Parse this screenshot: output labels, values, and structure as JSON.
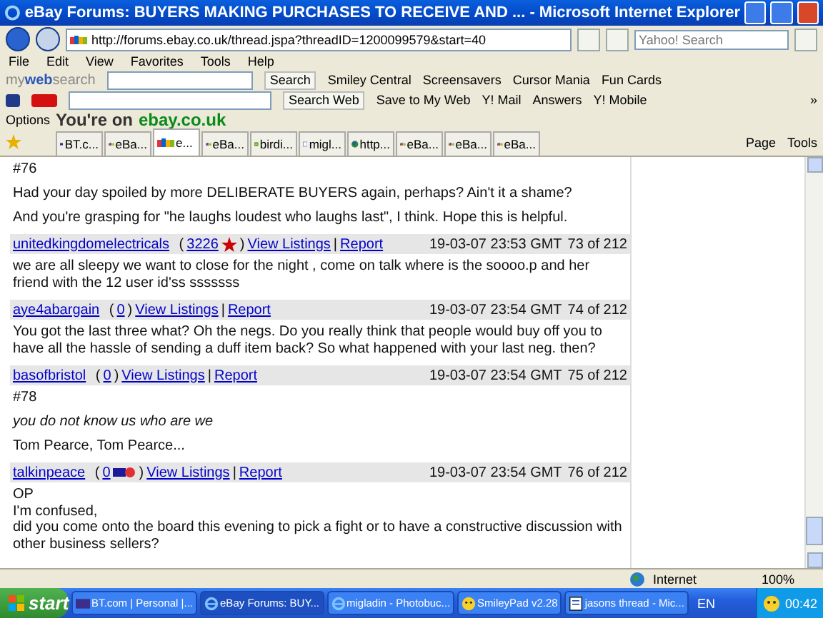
{
  "window": {
    "title": "eBay Forums: BUYERS MAKING PURCHASES TO RECEIVE AND ... - Microsoft Internet Explorer"
  },
  "address_bar": {
    "url": "http://forums.ebay.co.uk/thread.jspa?threadID=1200099579&start=40",
    "search_placeholder": "Yahoo! Search"
  },
  "menu": [
    "File",
    "Edit",
    "View",
    "Favorites",
    "Tools",
    "Help"
  ],
  "mywebsearch_toolbar": {
    "logo": "my**web**search",
    "search_button": "Search",
    "items": [
      "Smiley Central",
      "Screensavers",
      "Cursor Mania",
      "Fun Cards"
    ]
  },
  "yahoo_toolbar": {
    "search_button": "Search Web",
    "items": [
      "Save to My Web",
      "Y! Mail",
      "Answers",
      "Y! Mobile"
    ],
    "more": "»"
  },
  "ebay_bar": {
    "options": "Options",
    "prefix": "You're on",
    "site": "ebay.co.uk"
  },
  "tabs": [
    {
      "label": "BT.c...",
      "selected": false,
      "kind": "bt"
    },
    {
      "label": "eBa...",
      "selected": false,
      "kind": "ebay"
    },
    {
      "label": "e...",
      "selected": true,
      "kind": "ebay"
    },
    {
      "label": "eBa...",
      "selected": false,
      "kind": "ebay"
    },
    {
      "label": "birdi...",
      "selected": false,
      "kind": "green"
    },
    {
      "label": "migl...",
      "selected": false,
      "kind": "page"
    },
    {
      "label": "http...",
      "selected": false,
      "kind": "globe"
    },
    {
      "label": "eBa...",
      "selected": false,
      "kind": "ebay"
    },
    {
      "label": "eBa...",
      "selected": false,
      "kind": "ebay"
    },
    {
      "label": "eBa...",
      "selected": false,
      "kind": "ebay"
    }
  ],
  "command_bar": [
    "Page",
    "Tools"
  ],
  "first_post_body": [
    {
      "kind": "plain",
      "text": "#76"
    },
    {
      "kind": "plain",
      "text": "Had your day spoiled by more DELIBERATE BUYERS again, perhaps? Ain't it a shame?"
    },
    {
      "kind": "plain",
      "text": "And you're grasping for \"he laughs loudest who laughs last\", I think. Hope this is helpful."
    }
  ],
  "posts": [
    {
      "author": "unitedkingdomelectricals",
      "open": "(",
      "feedback": "3226",
      "close": ")",
      "badges": [
        {
          "kind": "star"
        }
      ],
      "view_listings": "View Listings",
      "separator": "|",
      "report": "Report",
      "date": "19-03-07 23:53 GMT",
      "position": "73 of 212",
      "body": [
        {
          "kind": "plain",
          "text": "we are all sleepy we want to close for the night , come on talk where is the soooo.p and her friend with the 12 user id'ss sssssss"
        }
      ]
    },
    {
      "author": "aye4abargain",
      "open": "(",
      "feedback": "0",
      "close": ")",
      "view_listings": "View Listings",
      "separator": "|",
      "report": "Report",
      "date": "19-03-07 23:54 GMT",
      "position": "74 of 212",
      "body": [
        {
          "kind": "plain",
          "text": "You got the last three what? Oh the negs. Do you really think that people would buy off you to have all the hassle of sending a duff item back? So what happened with your last neg. then?"
        }
      ]
    },
    {
      "author": "basofbristol",
      "open": "(",
      "feedback": "0",
      "close": ")",
      "view_listings": "View Listings",
      "separator": "|",
      "report": "Report",
      "date": "19-03-07 23:54 GMT",
      "position": "75 of 212",
      "body": [
        {
          "kind": "plain",
          "text": "#78"
        },
        {
          "kind": "italic",
          "text": "you do not know us who are we"
        },
        {
          "kind": "plain",
          "text": "Tom Pearce, Tom Pearce..."
        }
      ]
    },
    {
      "author": "talkinpeace",
      "open": "(",
      "feedback": "0",
      "close": ")",
      "badges": [
        {
          "kind": "me"
        }
      ],
      "view_listings": "View Listings",
      "separator": "|",
      "report": "Report",
      "date": "19-03-07 23:54 GMT",
      "position": "76 of 212",
      "body": [
        {
          "kind": "lines",
          "lines": [
            "OP",
            "I'm confused,",
            "did you come onto the board this evening to pick a fight or to have a constructive discussion with other business sellers?"
          ]
        }
      ]
    }
  ],
  "status_bar": {
    "zone": "Internet",
    "zoom": "100%"
  },
  "taskbar": {
    "start": "start",
    "items": [
      {
        "label": "BT.com | Personal |...",
        "selected": false,
        "kind": "bt"
      },
      {
        "label": "eBay Forums: BUY...",
        "selected": true,
        "kind": "ie"
      },
      {
        "label": "migladin - Photobuc...",
        "selected": false,
        "kind": "ie"
      },
      {
        "label": "SmileyPad v2.28",
        "selected": false,
        "kind": "smiley"
      },
      {
        "label": "jasons thread - Mic...",
        "selected": false,
        "kind": "doc"
      }
    ],
    "language": "EN",
    "clock": "00:42"
  }
}
